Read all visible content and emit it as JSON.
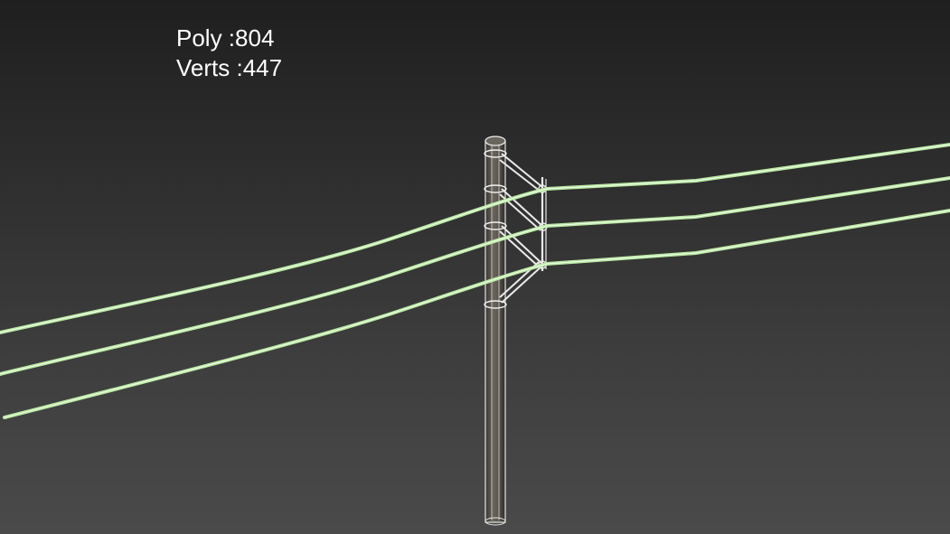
{
  "viewport": {
    "stats": {
      "poly_label": "Poly :804",
      "verts_label": "Verts :447"
    }
  },
  "scene": {
    "objects": [
      "utility-pole",
      "crossarm-bracket",
      "power-line-top",
      "power-line-middle",
      "power-line-bottom"
    ],
    "colors": {
      "background_top": "#1f1f1f",
      "background_bottom": "#4a4a4a",
      "wire": "#b8e6a0",
      "wire_outline": "#e8ffe0",
      "pole": "#5a554e",
      "wireframe": "#e6e6e6"
    }
  }
}
